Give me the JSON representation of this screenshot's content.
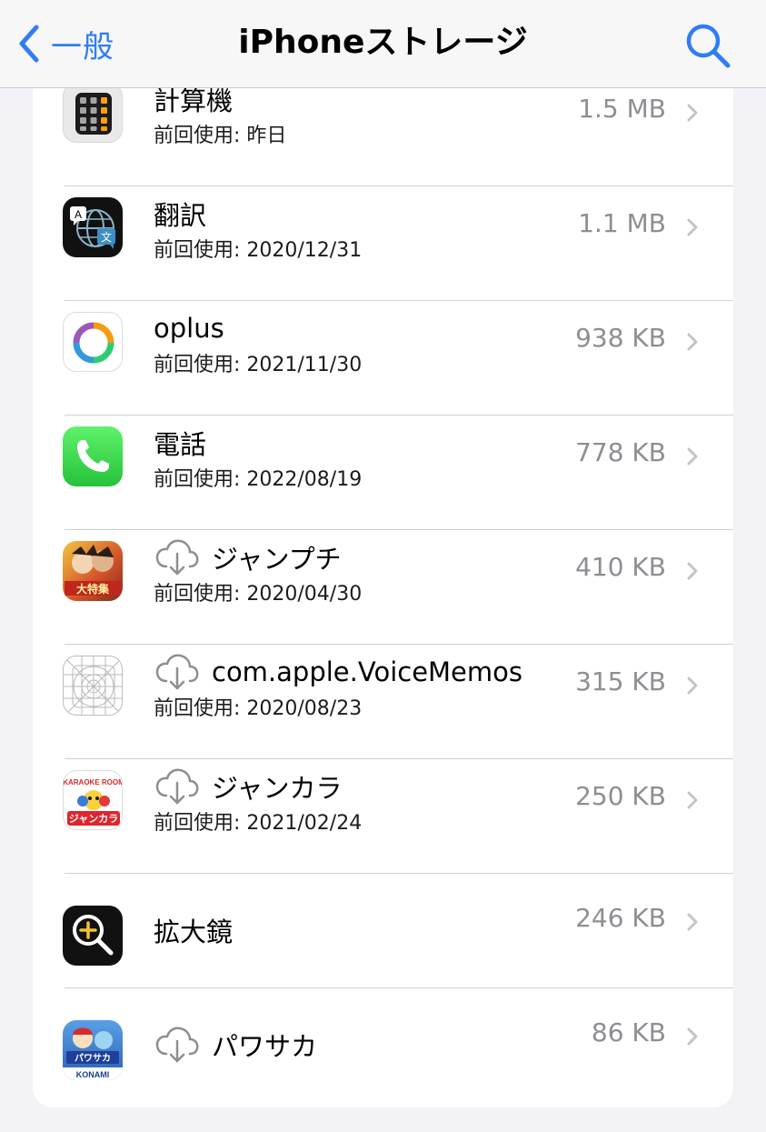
{
  "nav": {
    "back_label": "一般",
    "title": "iPhoneストレージ"
  },
  "colors": {
    "accent": "#2f7cf6",
    "secondary_text": "#8e8e93",
    "separator": "#d1d1d6",
    "background": "#f2f2f7"
  },
  "apps": [
    {
      "name": "計算機",
      "last_used": "前回使用: 昨日",
      "size": "1.5 MB",
      "icon": "calculator-icon",
      "offloaded": false
    },
    {
      "name": "翻訳",
      "last_used": "前回使用: 2020/12/31",
      "size": "1.1 MB",
      "icon": "translate-icon",
      "offloaded": false
    },
    {
      "name": "oplus",
      "last_used": "前回使用: 2021/11/30",
      "size": "938 KB",
      "icon": "oplus-icon",
      "offloaded": false
    },
    {
      "name": "電話",
      "last_used": "前回使用: 2022/08/19",
      "size": "778 KB",
      "icon": "phone-icon",
      "offloaded": false
    },
    {
      "name": "ジャンプチ",
      "last_used": "前回使用: 2020/04/30",
      "size": "410 KB",
      "icon": "jumputi-icon",
      "offloaded": true
    },
    {
      "name": "com.apple.VoiceMemos",
      "last_used": "前回使用: 2020/08/23",
      "size": "315 KB",
      "icon": "placeholder-app-icon",
      "offloaded": true
    },
    {
      "name": "ジャンカラ",
      "last_used": "前回使用: 2021/02/24",
      "size": "250 KB",
      "icon": "jankara-icon",
      "offloaded": true
    },
    {
      "name": "拡大鏡",
      "last_used": "",
      "size": "246 KB",
      "icon": "magnifier-icon",
      "offloaded": false
    },
    {
      "name": "パワサカ",
      "last_used": "",
      "size": "86 KB",
      "icon": "pawasaka-icon",
      "offloaded": true
    }
  ],
  "icon_texts": {
    "translate_a": "A",
    "translate_b": "文",
    "jumputi": "大特集",
    "jankara_top": "KARAOKE ROOM",
    "jankara_bottom": "ジャンカラ",
    "pawasaka_logo": "パワサカ",
    "pawasaka_brand": "KONAMI"
  }
}
